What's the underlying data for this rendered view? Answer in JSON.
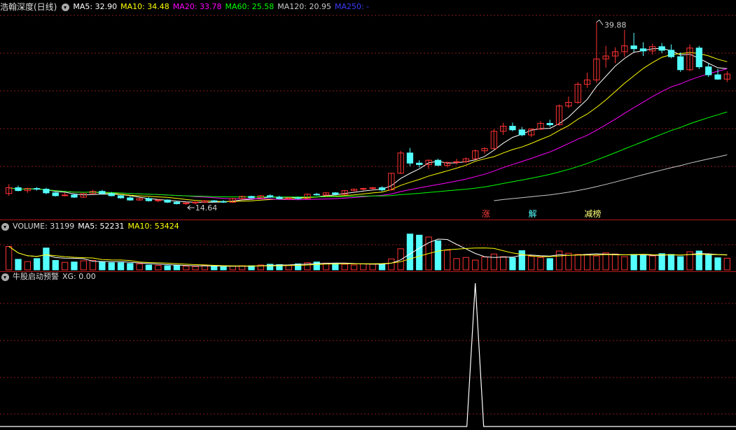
{
  "price_panel": {
    "title": "浩翰深度(日线)",
    "ma5": "MA5: 32.90",
    "ma10": "MA10: 34.48",
    "ma20": "MA20: 33.78",
    "ma60": "MA60: 25.58",
    "ma120": "MA120: 20.95",
    "ma250": "MA250: -",
    "high_label": "39.88",
    "low_label": "14.64"
  },
  "markers": {
    "zhang": "涨",
    "jie": "解",
    "jianchi": "减榜"
  },
  "volume_panel": {
    "title": "VOLUME: 31199",
    "ma5": "MA5: 52231",
    "ma10": "MA10: 53424"
  },
  "signal_panel": {
    "title": "牛股启动预警",
    "xg": "XG: 0.00"
  },
  "colors": {
    "up": "#ff3232",
    "down": "#54ffff",
    "ma5": "#ffffff",
    "ma10": "#ffff00",
    "ma20": "#ff00ff",
    "ma60": "#00ff00",
    "ma120": "#c8c8c8",
    "ma250": "#0000ff",
    "grid": "#8b1a1a"
  },
  "chart_data": {
    "type": "candlestick",
    "ylim": [
      14.64,
      39.88
    ],
    "close_first": 16.2,
    "candles": [
      [
        16.2,
        17.5,
        15.9,
        17.0
      ],
      [
        17.0,
        17.3,
        16.5,
        16.6
      ],
      [
        16.6,
        17.0,
        16.3,
        16.9
      ],
      [
        16.9,
        17.1,
        16.6,
        16.8
      ],
      [
        16.8,
        17.0,
        16.1,
        16.3
      ],
      [
        16.3,
        16.4,
        15.8,
        15.9
      ],
      [
        15.9,
        16.3,
        15.8,
        16.0
      ],
      [
        16.0,
        16.2,
        15.6,
        15.7
      ],
      [
        15.7,
        16.3,
        15.6,
        16.2
      ],
      [
        16.2,
        16.7,
        16.1,
        16.5
      ],
      [
        16.5,
        16.7,
        16.1,
        16.2
      ],
      [
        16.2,
        16.4,
        15.8,
        15.9
      ],
      [
        15.9,
        16.0,
        15.5,
        15.6
      ],
      [
        15.6,
        15.8,
        15.2,
        15.3
      ],
      [
        15.3,
        15.6,
        15.2,
        15.5
      ],
      [
        15.5,
        15.7,
        15.1,
        15.2
      ],
      [
        15.2,
        15.4,
        15.0,
        15.3
      ],
      [
        15.3,
        15.4,
        14.9,
        15.0
      ],
      [
        15.0,
        15.2,
        14.7,
        14.8
      ],
      [
        14.8,
        15.0,
        14.64,
        14.9
      ],
      [
        14.9,
        15.1,
        14.7,
        15.0
      ],
      [
        15.0,
        15.3,
        14.9,
        15.2
      ],
      [
        15.2,
        15.3,
        15.0,
        15.1
      ],
      [
        15.1,
        15.3,
        14.9,
        15.0
      ],
      [
        15.0,
        15.6,
        14.9,
        15.5
      ],
      [
        15.5,
        15.9,
        15.3,
        15.8
      ],
      [
        15.8,
        15.9,
        15.5,
        15.6
      ],
      [
        15.6,
        16.0,
        15.5,
        15.9
      ],
      [
        15.9,
        16.1,
        15.6,
        15.7
      ],
      [
        15.7,
        15.9,
        15.4,
        15.5
      ],
      [
        15.5,
        15.7,
        15.3,
        15.6
      ],
      [
        15.6,
        15.8,
        15.4,
        15.5
      ],
      [
        15.5,
        16.2,
        15.4,
        16.1
      ],
      [
        16.1,
        16.3,
        15.9,
        16.0
      ],
      [
        16.0,
        16.4,
        15.8,
        16.3
      ],
      [
        16.3,
        16.4,
        16.0,
        16.1
      ],
      [
        16.1,
        16.7,
        16.0,
        16.6
      ],
      [
        16.6,
        16.9,
        16.5,
        16.8
      ],
      [
        16.8,
        17.0,
        16.6,
        16.9
      ],
      [
        16.9,
        17.1,
        16.7,
        17.0
      ],
      [
        17.0,
        17.2,
        16.5,
        16.7
      ],
      [
        16.7,
        19.0,
        16.6,
        19.0
      ],
      [
        19.0,
        22.1,
        18.9,
        21.8
      ],
      [
        21.8,
        22.5,
        20.0,
        20.4
      ],
      [
        20.4,
        20.8,
        19.8,
        20.2
      ],
      [
        20.2,
        20.9,
        19.6,
        20.8
      ],
      [
        20.8,
        21.0,
        20.0,
        20.1
      ],
      [
        20.1,
        20.6,
        19.8,
        20.5
      ],
      [
        20.5,
        21.0,
        20.2,
        20.6
      ],
      [
        20.6,
        21.2,
        20.4,
        21.0
      ],
      [
        21.0,
        22.3,
        20.9,
        22.1
      ],
      [
        22.1,
        22.6,
        21.7,
        22.4
      ],
      [
        22.4,
        25.1,
        22.3,
        24.8
      ],
      [
        24.8,
        26.0,
        24.3,
        25.5
      ],
      [
        25.5,
        26.0,
        24.8,
        25.0
      ],
      [
        25.0,
        25.4,
        24.1,
        24.3
      ],
      [
        24.3,
        25.2,
        24.0,
        25.1
      ],
      [
        25.1,
        26.2,
        25.0,
        25.9
      ],
      [
        25.9,
        26.4,
        25.4,
        25.7
      ],
      [
        25.7,
        28.5,
        25.6,
        28.3
      ],
      [
        28.3,
        29.6,
        28.0,
        28.8
      ],
      [
        28.8,
        31.6,
        28.6,
        31.3
      ],
      [
        31.3,
        32.9,
        30.8,
        31.9
      ],
      [
        31.9,
        39.88,
        31.5,
        34.8
      ],
      [
        34.8,
        36.6,
        33.6,
        35.2
      ],
      [
        35.2,
        36.4,
        34.2,
        35.8
      ],
      [
        35.8,
        38.8,
        35.1,
        36.6
      ],
      [
        36.6,
        38.4,
        35.7,
        36.2
      ],
      [
        36.2,
        37.1,
        35.2,
        35.9
      ],
      [
        35.9,
        36.9,
        35.4,
        36.5
      ],
      [
        36.5,
        37.0,
        35.6,
        36.0
      ],
      [
        36.0,
        36.8,
        34.9,
        35.1
      ],
      [
        35.1,
        35.7,
        33.0,
        33.3
      ],
      [
        33.3,
        36.8,
        33.1,
        36.3
      ],
      [
        36.3,
        36.6,
        33.4,
        33.7
      ],
      [
        33.7,
        34.2,
        32.3,
        32.6
      ],
      [
        32.6,
        33.4,
        31.9,
        32.0
      ],
      [
        32.0,
        33.1,
        31.6,
        32.7
      ]
    ],
    "markers": [
      {
        "index": 51,
        "label": "涨"
      },
      {
        "index": 56,
        "label": "解"
      },
      {
        "index": 62,
        "label": "减榜"
      }
    ],
    "volume": [
      62,
      28,
      22,
      30,
      58,
      25,
      20,
      21,
      24,
      25,
      21,
      19,
      19,
      17,
      16,
      13,
      12,
      11,
      12,
      10,
      9,
      12,
      9,
      8,
      10,
      11,
      11,
      13,
      15,
      14,
      13,
      16,
      19,
      21,
      18,
      17,
      15,
      13,
      16,
      15,
      16,
      29,
      56,
      95,
      92,
      87,
      77,
      52,
      30,
      33,
      26,
      34,
      42,
      35,
      32,
      51,
      36,
      33,
      30,
      50,
      44,
      41,
      41,
      37,
      45,
      42,
      35,
      41,
      38,
      37,
      43,
      41,
      35,
      48,
      50,
      39,
      32,
      31
    ],
    "signal_spike_index": 50,
    "signal_value": 0.0
  }
}
